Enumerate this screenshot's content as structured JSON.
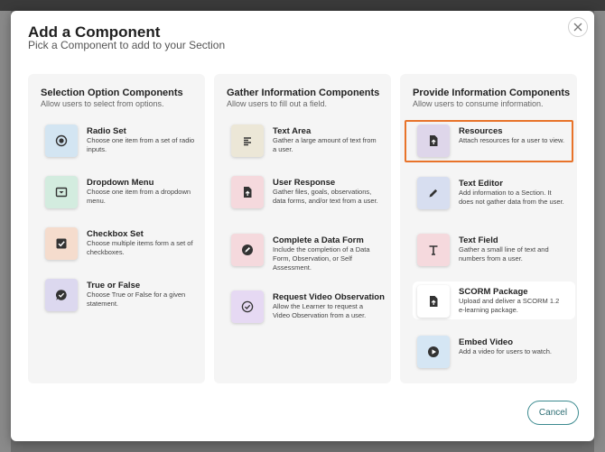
{
  "modal": {
    "title": "Add a Component",
    "subtitle": "Pick a Component to add to your Section",
    "cancel_label": "Cancel"
  },
  "columns": [
    {
      "title": "Selection Option Components",
      "subtitle": "Allow users to select from options.",
      "items": [
        {
          "title": "Radio Set",
          "desc": "Choose one item from a set of radio inputs.",
          "icon": "radio-icon",
          "color": "#d3e5f2"
        },
        {
          "title": "Dropdown Menu",
          "desc": "Choose one item from a dropdown menu.",
          "icon": "dropdown-icon",
          "color": "#d3ecdf"
        },
        {
          "title": "Checkbox Set",
          "desc": "Choose multiple items form a set of checkboxes.",
          "icon": "checkbox-icon",
          "color": "#f5dccd"
        },
        {
          "title": "True or False",
          "desc": "Choose True or False for a given statement.",
          "icon": "check-bubble-icon",
          "color": "#dcd8ef"
        }
      ]
    },
    {
      "title": "Gather Information Components",
      "subtitle": "Allow users to fill out a field.",
      "items": [
        {
          "title": "Text Area",
          "desc": "Gather a large amount of text from a user.",
          "icon": "text-align-icon",
          "color": "#ece7d7"
        },
        {
          "title": "User Response",
          "desc": "Gather files, goals, observations, data forms, and/or text from a user.",
          "icon": "file-upload-icon",
          "color": "#f5d9dd"
        },
        {
          "title": "Complete a Data Form",
          "desc": "Include the completion of a Data Form, Observation, or Self Assessment.",
          "icon": "pen-circle-icon",
          "color": "#f5d9dd"
        },
        {
          "title": "Request Video Observation",
          "desc": "Allow the Learner to request a Video Observation from a user.",
          "icon": "check-circle-icon",
          "color": "#e6d9f3"
        }
      ]
    },
    {
      "title": "Provide Information Components",
      "subtitle": "Allow users to consume information.",
      "items": [
        {
          "title": "Resources",
          "desc": "Attach resources for a user to view.",
          "icon": "file-upload-icon",
          "color": "#ded6ea"
        },
        {
          "title": "Text Editor",
          "desc": "Add information to a Section. It does not gather data from the user.",
          "icon": "pen-icon",
          "color": "#d7def0"
        },
        {
          "title": "Text Field",
          "desc": "Gather a small line of text and numbers from a user.",
          "icon": "text-icon",
          "color": "#f5d9dd"
        },
        {
          "title": "SCORM Package",
          "desc": "Upload and deliver a SCORM 1.2 e-learning package.",
          "icon": "file-upload-icon",
          "color": "#ffffff"
        },
        {
          "title": "Embed Video",
          "desc": "Add a video for users to watch.",
          "icon": "play-icon",
          "color": "#d5e6f4"
        }
      ]
    }
  ],
  "selected_item": "Resources",
  "accent_color": "#e8732a",
  "button_color": "#3b8a8f"
}
